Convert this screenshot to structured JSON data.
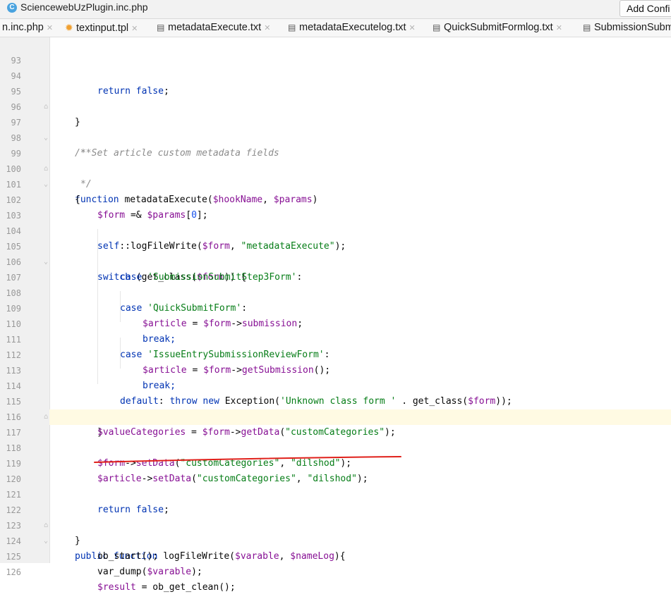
{
  "window": {
    "title": "SciencewebUzPlugin.inc.php",
    "action_button": "Add Confi"
  },
  "tabs": [
    {
      "label": "n.inc.php",
      "icon": ""
    },
    {
      "label": "textinput.tpl",
      "icon": "sun-icon"
    },
    {
      "label": "metadataExecute.txt",
      "icon": "file-icon"
    },
    {
      "label": "metadataExecutelog.txt",
      "icon": "file-icon"
    },
    {
      "label": "QuickSubmitFormlog.txt",
      "icon": "file-icon"
    },
    {
      "label": "SubmissionSubmi",
      "icon": "file-icon"
    }
  ],
  "editor": {
    "line_numbers": [
      "93",
      "94",
      "95",
      "96",
      "97",
      "98",
      "99",
      "100",
      "101",
      "102",
      "103",
      "104",
      "105",
      "106",
      "107",
      "108",
      "109",
      "110",
      "111",
      "112",
      "113",
      "114",
      "115",
      "116",
      "117",
      "118",
      "119",
      "120",
      "121",
      "122",
      "123",
      "124",
      "125",
      "126"
    ],
    "lines": [
      "",
      "return false;",
      "}",
      "",
      "/**",
      "* Set article custom metadata fields",
      "*/",
      "function metadataExecute($hookName, $params)",
      "{",
      "$form =& $params[0];",
      "",
      "self::logFileWrite($form, \"metadataExecute\");",
      "switch (get_class($form)) {",
      "case 'SubmissionSubmitStep3Form':",
      "",
      "case 'QuickSubmitForm':",
      "$article = $form->submission;",
      "break;",
      "case 'IssueEntrySubmissionReviewForm':",
      "$article = $form->getSubmission();",
      "break;",
      "default: throw new Exception('Unknown class form ' . get_class($form));",
      "}",
      "$valueCategories = $form->getData(\"customCategories\");",
      "",
      "$form->setData(\"customCategories\", \"dilshod\");",
      "$article->setData(\"customCategories\", \"dilshod\");",
      "",
      "return false;",
      "}",
      "public function logFileWrite($varable, $nameLog){",
      "ob_start();",
      "var_dump($varable);",
      "$result = ob_get_clean();"
    ]
  },
  "colors": {
    "keyword": "#0033b3",
    "variable": "#871094",
    "string": "#067d17",
    "comment": "#8c8c8c",
    "function": "#00627a",
    "annotation_underline": "#e0201a",
    "current_line": "#fffae3"
  }
}
